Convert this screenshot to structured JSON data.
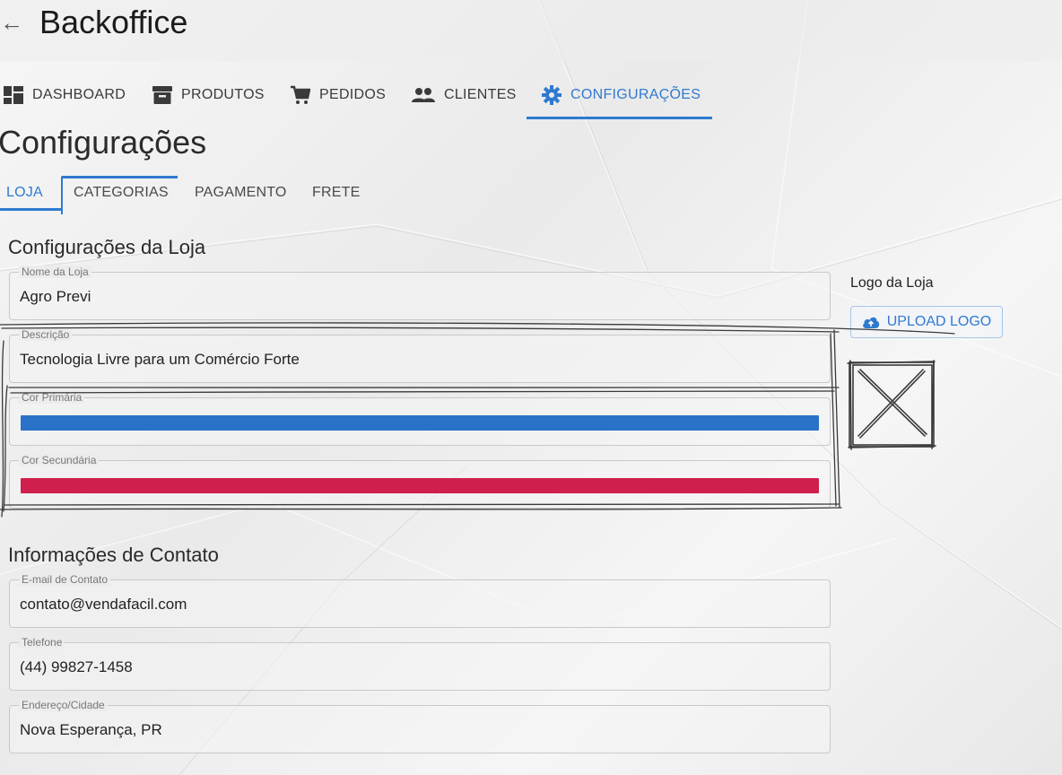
{
  "header": {
    "back_icon": "arrow-left-icon",
    "title": "Backoffice"
  },
  "nav": {
    "items": [
      {
        "label": "DASHBOARD",
        "icon": "dashboard-icon"
      },
      {
        "label": "PRODUTOS",
        "icon": "archive-box-icon"
      },
      {
        "label": "PEDIDOS",
        "icon": "shopping-cart-icon"
      },
      {
        "label": "CLIENTES",
        "icon": "people-icon"
      },
      {
        "label": "CONFIGURAÇÕES",
        "icon": "gear-icon",
        "active": true
      }
    ]
  },
  "page": {
    "title": "Configurações"
  },
  "subtabs": [
    {
      "label": "LOJA",
      "active": true
    },
    {
      "label": "CATEGORIAS"
    },
    {
      "label": "PAGAMENTO"
    },
    {
      "label": "FRETE"
    }
  ],
  "store": {
    "section_title": "Configurações da Loja",
    "name": {
      "label": "Nome da Loja",
      "value": "Agro Previ"
    },
    "description": {
      "label": "Descrição",
      "value": "Tecnologia Livre para um Comércio Forte"
    },
    "primary_color": {
      "label": "Cor Primária",
      "value": "#2a72c8"
    },
    "secondary_color": {
      "label": "Cor Secundária",
      "value": "#cf1f4c"
    }
  },
  "logo": {
    "label": "Logo da Loja",
    "upload_label": "UPLOAD LOGO",
    "upload_icon": "cloud-upload-icon"
  },
  "contact": {
    "section_title": "Informações de Contato",
    "email": {
      "label": "E-mail de Contato",
      "value": "contato@vendafacil.com"
    },
    "phone": {
      "label": "Telefone",
      "value": "(44) 99827-1458"
    },
    "address": {
      "label": "Endereço/Cidade",
      "value": "Nova Esperança, PR"
    }
  },
  "colors": {
    "accent": "#2f7ad0"
  }
}
